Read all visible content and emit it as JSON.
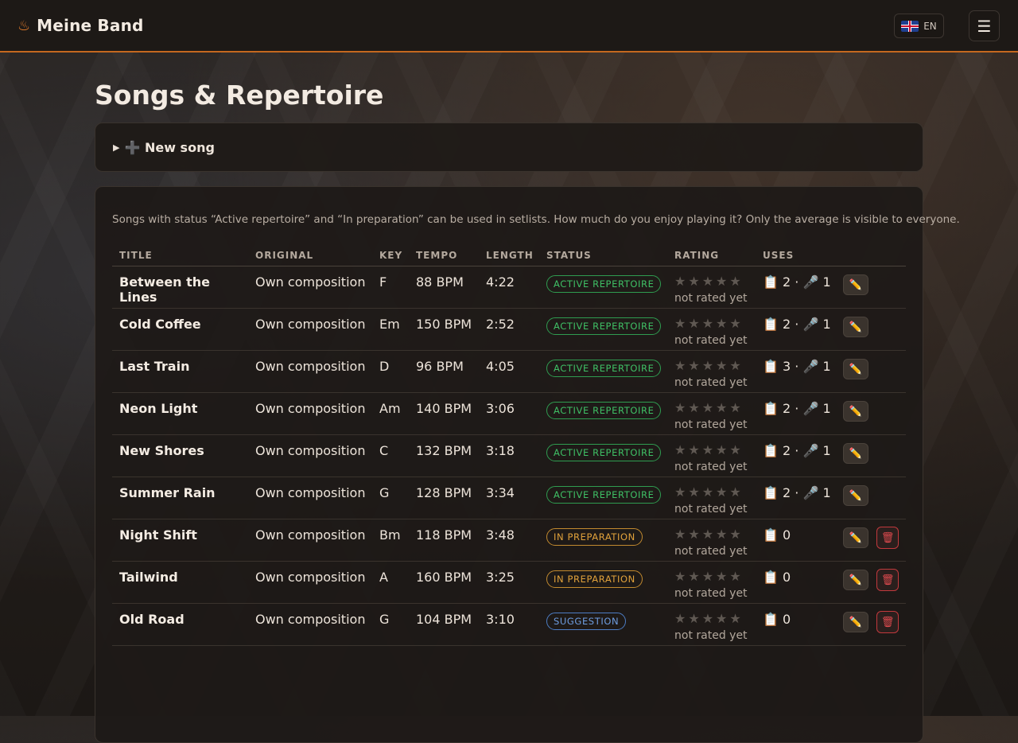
{
  "header": {
    "brand_icon": "flame-icon",
    "brand_name": "Meine Band",
    "language": "EN",
    "menu_icon": "☰"
  },
  "page": {
    "title": "Songs & Repertoire",
    "new_song_label": "➕ New song",
    "hint": "Songs with status “Active repertoire” and “In preparation” can be used in setlists. How much do you enjoy playing it? Only the average is visible to everyone."
  },
  "table": {
    "headers": [
      "TITLE",
      "ORIGINAL",
      "KEY",
      "TEMPO",
      "LENGTH",
      "STATUS",
      "RATING",
      "USES"
    ],
    "rows": [
      {
        "title": "Between the Lines",
        "original": "Own composition",
        "key": "F",
        "tempo": "88 BPM",
        "length": "4:22",
        "status": "ACTIVE REPERTOIRE",
        "status_type": "active",
        "stars": "★★★★★",
        "rating_note": "not rated yet",
        "uses": "📋 2 · 🎤 1",
        "deletable": false
      },
      {
        "title": "Cold Coffee",
        "original": "Own composition",
        "key": "Em",
        "tempo": "150 BPM",
        "length": "2:52",
        "status": "ACTIVE REPERTOIRE",
        "status_type": "active",
        "stars": "★★★★★",
        "rating_note": "not rated yet",
        "uses": "📋 2 · 🎤 1",
        "deletable": false
      },
      {
        "title": "Last Train",
        "original": "Own composition",
        "key": "D",
        "tempo": "96 BPM",
        "length": "4:05",
        "status": "ACTIVE REPERTOIRE",
        "status_type": "active",
        "stars": "★★★★★",
        "rating_note": "not rated yet",
        "uses": "📋 3 · 🎤 1",
        "deletable": false
      },
      {
        "title": "Neon Light",
        "original": "Own composition",
        "key": "Am",
        "tempo": "140 BPM",
        "length": "3:06",
        "status": "ACTIVE REPERTOIRE",
        "status_type": "active",
        "stars": "★★★★★",
        "rating_note": "not rated yet",
        "uses": "📋 2 · 🎤 1",
        "deletable": false
      },
      {
        "title": "New Shores",
        "original": "Own composition",
        "key": "C",
        "tempo": "132 BPM",
        "length": "3:18",
        "status": "ACTIVE REPERTOIRE",
        "status_type": "active",
        "stars": "★★★★★",
        "rating_note": "not rated yet",
        "uses": "📋 2 · 🎤 1",
        "deletable": false
      },
      {
        "title": "Summer Rain",
        "original": "Own composition",
        "key": "G",
        "tempo": "128 BPM",
        "length": "3:34",
        "status": "ACTIVE REPERTOIRE",
        "status_type": "active",
        "stars": "★★★★★",
        "rating_note": "not rated yet",
        "uses": "📋 2 · 🎤 1",
        "deletable": false
      },
      {
        "title": "Night Shift",
        "original": "Own composition",
        "key": "Bm",
        "tempo": "118 BPM",
        "length": "3:48",
        "status": "IN PREPARATION",
        "status_type": "prep",
        "stars": "★★★★★",
        "rating_note": "not rated yet",
        "uses": "📋 0",
        "deletable": true
      },
      {
        "title": "Tailwind",
        "original": "Own composition",
        "key": "A",
        "tempo": "160 BPM",
        "length": "3:25",
        "status": "IN PREPARATION",
        "status_type": "prep",
        "stars": "★★★★★",
        "rating_note": "not rated yet",
        "uses": "📋 0",
        "deletable": true
      },
      {
        "title": "Old Road",
        "original": "Own composition",
        "key": "G",
        "tempo": "104 BPM",
        "length": "3:10",
        "status": "SUGGESTION",
        "status_type": "sugg",
        "stars": "★★★★★",
        "rating_note": "not rated yet",
        "uses": "📋 0",
        "deletable": true
      }
    ]
  },
  "icons": {
    "edit": "pencil-icon",
    "delete": "trash-icon"
  },
  "colors": {
    "accent": "#c4681f",
    "active": "#3fbf65",
    "prep": "#e0a13b",
    "suggestion": "#6e9de0",
    "danger": "#e04b4f"
  }
}
